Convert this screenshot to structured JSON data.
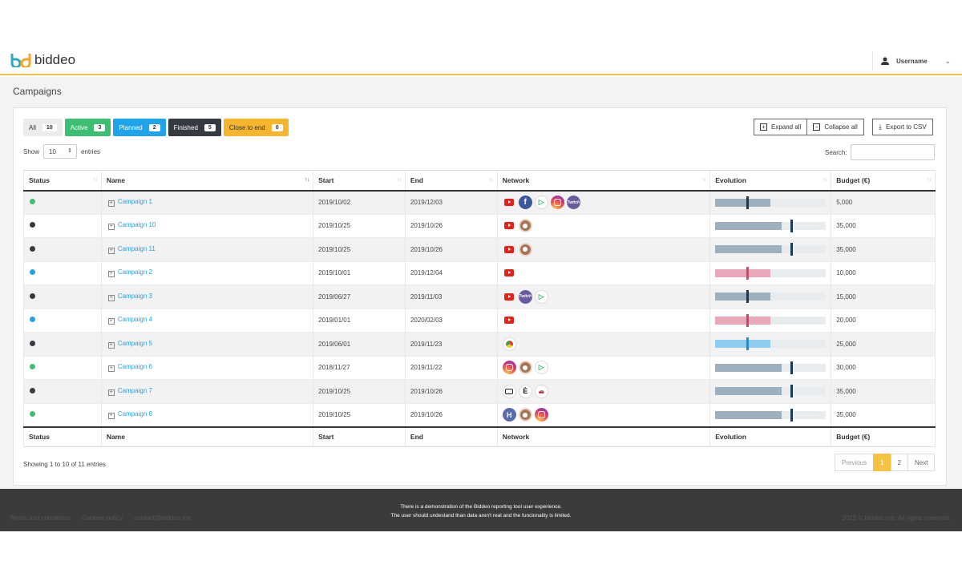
{
  "brand": {
    "name": "biddeo"
  },
  "user": {
    "name": "Username"
  },
  "page": {
    "title": "Campaigns"
  },
  "filters": [
    {
      "label": "All",
      "count": "10"
    },
    {
      "label": "Active",
      "count": "3"
    },
    {
      "label": "Planned",
      "count": "2"
    },
    {
      "label": "Finished",
      "count": "5"
    },
    {
      "label": "Close to end",
      "count": "0"
    }
  ],
  "actions": {
    "expand_all": "Expand all",
    "collapse_all": "Collapse all",
    "export": "Export to CSV"
  },
  "length": {
    "show": "Show",
    "value": "10",
    "entries": "entries"
  },
  "search": {
    "label": "Search:"
  },
  "columns": [
    "Status",
    "Name",
    "Start",
    "End",
    "Network",
    "Evolution",
    "Budget (€)"
  ],
  "rows": [
    {
      "status": "active",
      "name": "Campaign 1",
      "start": "2019/10/02",
      "end": "2019/12/03",
      "network": [
        "youtube",
        "facebook",
        "google-play",
        "instagram",
        "twitch"
      ],
      "evo_color": "slate",
      "evo_fill": 0.5,
      "evo_marker": 0.28,
      "budget": "5,000"
    },
    {
      "status": "finished",
      "name": "Campaign 10",
      "start": "2019/10/25",
      "end": "2019/10/26",
      "network": [
        "youtube",
        "cup"
      ],
      "evo_color": "slate",
      "evo_fill": 0.6,
      "evo_marker": 0.68,
      "budget": "35,000"
    },
    {
      "status": "finished",
      "name": "Campaign 11",
      "start": "2019/10/25",
      "end": "2019/10/26",
      "network": [
        "youtube",
        "cup"
      ],
      "evo_color": "slate",
      "evo_fill": 0.6,
      "evo_marker": 0.68,
      "budget": "35,000"
    },
    {
      "status": "planned",
      "name": "Campaign 2",
      "start": "2019/10/01",
      "end": "2019/12/04",
      "network": [
        "youtube"
      ],
      "evo_color": "pink",
      "evo_fill": 0.5,
      "evo_marker": 0.28,
      "budget": "10,000"
    },
    {
      "status": "finished",
      "name": "Campaign 3",
      "start": "2019/06/27",
      "end": "2019/11/03",
      "network": [
        "youtube",
        "twitch",
        "google-play"
      ],
      "evo_color": "slate",
      "evo_fill": 0.5,
      "evo_marker": 0.28,
      "budget": "15,000"
    },
    {
      "status": "planned",
      "name": "Campaign 4",
      "start": "2019/01/01",
      "end": "2020/02/03",
      "network": [
        "youtube"
      ],
      "evo_color": "pink",
      "evo_fill": 0.5,
      "evo_marker": 0.28,
      "budget": "20,000"
    },
    {
      "status": "finished",
      "name": "Campaign 5",
      "start": "2019/06/01",
      "end": "2019/11/23",
      "network": [
        "chrome"
      ],
      "evo_color": "sky",
      "evo_fill": 0.5,
      "evo_marker": 0.28,
      "budget": "25,000"
    },
    {
      "status": "active",
      "name": "Campaign 6",
      "start": "2018/11/27",
      "end": "2019/11/22",
      "network": [
        "instagram",
        "cup",
        "google-play"
      ],
      "evo_color": "slate",
      "evo_fill": 0.6,
      "evo_marker": 0.68,
      "budget": "30,000"
    },
    {
      "status": "finished",
      "name": "Campaign 7",
      "start": "2019/10/25",
      "end": "2019/10/26",
      "network": [
        "tv",
        "e-letter",
        "car"
      ],
      "evo_color": "slate",
      "evo_fill": 0.6,
      "evo_marker": 0.68,
      "budget": "35,000"
    },
    {
      "status": "active",
      "name": "Campaign 8",
      "start": "2019/10/25",
      "end": "2019/10/26",
      "network": [
        "h-app",
        "cup",
        "instagram"
      ],
      "evo_color": "slate",
      "evo_fill": 0.6,
      "evo_marker": 0.68,
      "budget": "35,000"
    }
  ],
  "status_colors": {
    "active": "#3cbf72",
    "planned": "#1fa4ec",
    "finished": "#343a40"
  },
  "evo_colors": {
    "slate": "#9eafbd",
    "pink": "#e9a7b8",
    "sky": "#8fcdf0"
  },
  "info": "Showing 1 to 10 of 11 entries",
  "pagination": {
    "previous": "Previous",
    "pages": [
      "1",
      "2"
    ],
    "next": "Next"
  },
  "footer": {
    "links": [
      "Terms and conditions",
      "Cookies policy",
      "contact@biddeo.me"
    ],
    "demo_line1": "There is a demonstration of the Biddeo reporting tool user experience.",
    "demo_line2": "The user should undestand than data aren't real and the funcionality is limited.",
    "copyright": "2021 © biddeo.me. All rights reserved."
  }
}
